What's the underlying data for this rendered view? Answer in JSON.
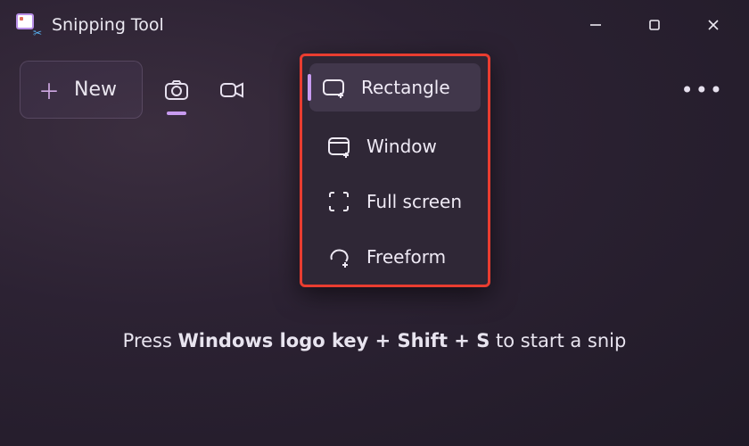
{
  "app": {
    "title": "Snipping Tool"
  },
  "toolbar": {
    "new_label": "New"
  },
  "modes": {
    "items": [
      {
        "label": "Rectangle"
      },
      {
        "label": "Window"
      },
      {
        "label": "Full screen"
      },
      {
        "label": "Freeform"
      }
    ]
  },
  "hint": {
    "pre": "Press ",
    "keys": "Windows logo key + Shift + S",
    "post": " to start a snip"
  }
}
